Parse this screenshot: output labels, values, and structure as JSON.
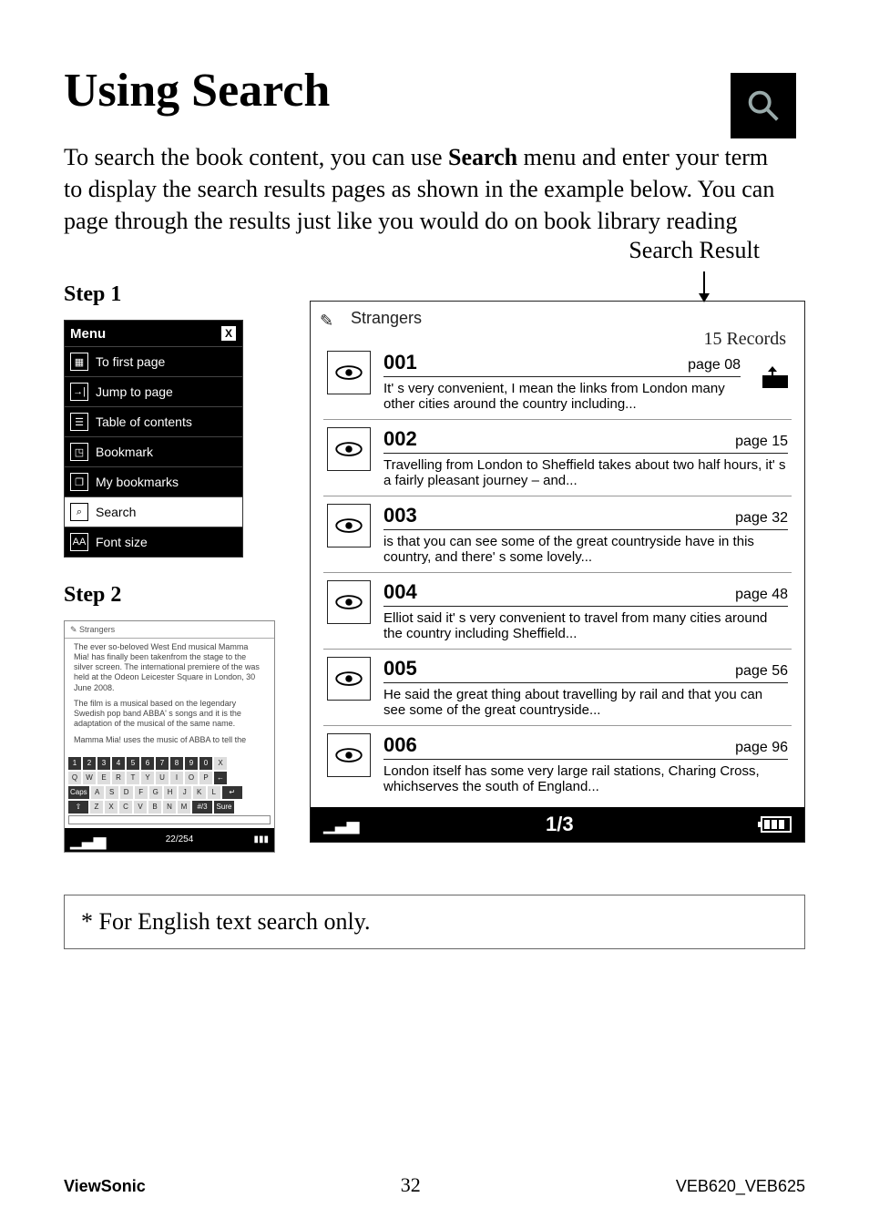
{
  "title": "Using Search",
  "intro_pre": "To search the book content, you can use ",
  "intro_bold": "Search",
  "intro_post": " menu and enter your term to display the search results pages as shown in the example below. You can page through the results just like you would do on book library reading",
  "step1_label": "Step 1",
  "step2_label": "Step 2",
  "menu": {
    "title": "Menu",
    "items": [
      {
        "label": "To first page",
        "icon": "grid-icon"
      },
      {
        "label": "Jump to page",
        "icon": "goto-icon"
      },
      {
        "label": "Table of contents",
        "icon": "toc-icon"
      },
      {
        "label": "Bookmark",
        "icon": "bookmark-icon"
      },
      {
        "label": "My bookmarks",
        "icon": "bookmarks-list-icon"
      },
      {
        "label": "Search",
        "icon": "search-icon"
      },
      {
        "label": "Font size",
        "icon": "fontsize-icon"
      }
    ]
  },
  "step2_screen": {
    "breadcrumb": "Strangers",
    "para1": "The ever so-beloved West End musical Mamma Mia! has finally been takenfrom the stage to the silver screen. The international premiere of the was held at the Odeon Leicester Square in London, 30 June 2008.",
    "para2": "The film is a musical based on the legendary Swedish pop band ABBA' s songs and it is the adaptation of the musical of the same name.",
    "para3": "Mamma Mia! uses the music of ABBA to tell the",
    "status": "22/254",
    "keyboard": {
      "row1": [
        "1",
        "2",
        "3",
        "4",
        "5",
        "6",
        "7",
        "8",
        "9",
        "0",
        "X"
      ],
      "row2": [
        "Q",
        "W",
        "E",
        "R",
        "T",
        "Y",
        "U",
        "I",
        "O",
        "P",
        "←"
      ],
      "row3": [
        "Caps",
        "A",
        "S",
        "D",
        "F",
        "G",
        "H",
        "J",
        "K",
        "L",
        "↵"
      ],
      "row4": [
        "⇧",
        "Z",
        "X",
        "C",
        "V",
        "B",
        "N",
        "M",
        "#/3",
        "Sure"
      ]
    }
  },
  "search_result_label": "Search Result",
  "results": {
    "query": "Strangers",
    "records_label": "15 Records",
    "pager": "1/3",
    "items": [
      {
        "num": "001",
        "page": "page 08",
        "snippet": "It' s very convenient, I mean the links from London many other cities around the country including..."
      },
      {
        "num": "002",
        "page": "page 15",
        "snippet": "Travelling from London to Sheffield takes about two half hours, it' s a fairly pleasant journey – and..."
      },
      {
        "num": "003",
        "page": "page 32",
        "snippet": "is that you can see some of the great countryside have in this country, and there' s some lovely..."
      },
      {
        "num": "004",
        "page": "page 48",
        "snippet": "Elliot said it' s very convenient to travel from many cities around the country including Sheffield..."
      },
      {
        "num": "005",
        "page": "page 56",
        "snippet": "He said the great thing about travelling by rail and that you can see some of the great countryside..."
      },
      {
        "num": "006",
        "page": "page 96",
        "snippet": "London itself has some very large rail stations, Charing Cross, whichserves the south of England..."
      }
    ]
  },
  "footnote": "* For English text search only.",
  "footer": {
    "brand": "ViewSonic",
    "page": "32",
    "model": "VEB620_VEB625"
  },
  "chart_data": {
    "type": "table",
    "title": "Search results for 'Strangers'",
    "columns": [
      "result_number",
      "page",
      "snippet"
    ],
    "rows": [
      [
        "001",
        "08",
        "It' s very convenient, I mean the links from London many other cities around the country including..."
      ],
      [
        "002",
        "15",
        "Travelling from London to Sheffield takes about two half hours, it' s a fairly pleasant journey – and..."
      ],
      [
        "003",
        "32",
        "is that you can see some of the great countryside have in this country, and there' s some lovely..."
      ],
      [
        "004",
        "48",
        "Elliot said it' s very convenient to travel from many cities around the country including Sheffield..."
      ],
      [
        "005",
        "56",
        "He said the great thing about travelling by rail and that you can see some of the great countryside..."
      ],
      [
        "006",
        "96",
        "London itself has some very large rail stations, Charing Cross, whichserves the south of England..."
      ]
    ],
    "total_records": 15,
    "page_indicator": "1/3"
  }
}
